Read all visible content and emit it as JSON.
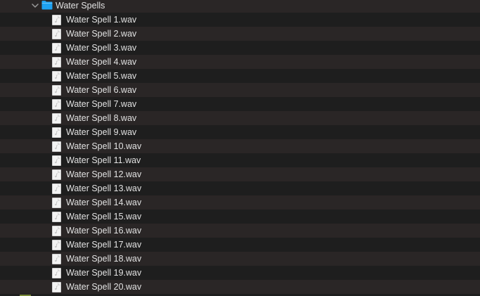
{
  "folder": {
    "name": "Water Spells",
    "expanded": true,
    "icon": "folder-icon",
    "color": "#1ea1f1"
  },
  "files": [
    {
      "name": "Water Spell 1.wav"
    },
    {
      "name": "Water Spell 2.wav"
    },
    {
      "name": "Water Spell 3.wav"
    },
    {
      "name": "Water Spell 4.wav"
    },
    {
      "name": "Water Spell 5.wav"
    },
    {
      "name": "Water Spell 6.wav"
    },
    {
      "name": "Water Spell 7.wav"
    },
    {
      "name": "Water Spell 8.wav"
    },
    {
      "name": "Water Spell 9.wav"
    },
    {
      "name": "Water Spell 10.wav"
    },
    {
      "name": "Water Spell 11.wav"
    },
    {
      "name": "Water Spell 12.wav"
    },
    {
      "name": "Water Spell 13.wav"
    },
    {
      "name": "Water Spell 14.wav"
    },
    {
      "name": "Water Spell 15.wav"
    },
    {
      "name": "Water Spell 16.wav"
    },
    {
      "name": "Water Spell 17.wav"
    },
    {
      "name": "Water Spell 18.wav"
    },
    {
      "name": "Water Spell 19.wav"
    },
    {
      "name": "Water Spell 20.wav"
    }
  ],
  "colors": {
    "row_even": "#2a2626",
    "row_odd": "#1e1e1e",
    "text": "#e2e2e2"
  }
}
